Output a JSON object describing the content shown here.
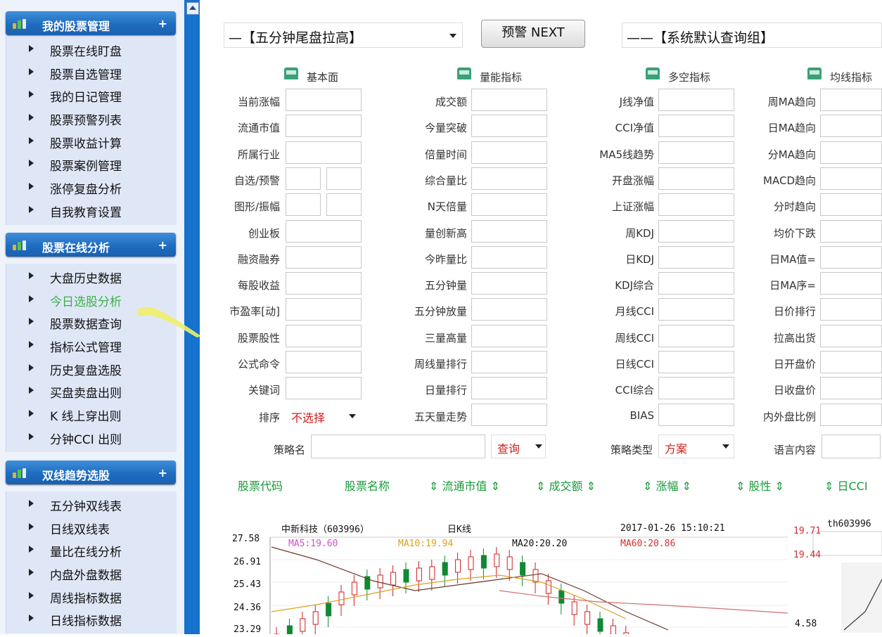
{
  "sidebar": {
    "sections": [
      {
        "title": "我的股票管理",
        "items": [
          "股票在线盯盘",
          "股票自选管理",
          "我的日记管理",
          "股票预警列表",
          "股票收益计算",
          "股票案例管理",
          "涨停复盘分析",
          "自我教育设置"
        ]
      },
      {
        "title": "股票在线分析",
        "items": [
          "大盘历史数据",
          "今日选股分析",
          "股票数据查询",
          "指标公式管理",
          "历史复盘选股",
          "买盘卖盘出则",
          "K 线上穿出则",
          "分钟CCI 出则"
        ]
      },
      {
        "title": "双线趋势选股",
        "items": [
          "五分钟双线表",
          "日线双线表",
          "量比在线分析",
          "内盘外盘数据",
          "周线指标数据",
          "日线指标数据"
        ]
      }
    ],
    "active_item": "今日选股分析",
    "colors": {
      "header": "#1f6cc0",
      "active": "#3fb04a",
      "scrollbar": "#1672cc"
    }
  },
  "toolbar": {
    "strategy_select": "—【五分钟尾盘拉高】",
    "next_button": "预警 NEXT",
    "query_group_select": "——【系统默认查询组】"
  },
  "columns": {
    "fundamental": {
      "title": "基本面",
      "labels": [
        "当前涨幅",
        "流通市值",
        "所属行业",
        "自选/预警",
        "图形/振幅",
        "创业板",
        "融资融券",
        "每股收益",
        "市盈率[动]",
        "股票股性",
        "公式命令",
        "关键词"
      ]
    },
    "volume": {
      "title": "量能指标",
      "labels": [
        "成交额",
        "今量突破",
        "倍量时间",
        "综合量比",
        "N天倍量",
        "量创新高",
        "今昨量比",
        "五分钟量",
        "五分钟放量",
        "三量高量",
        "周线量排行",
        "日量排行",
        "五天量走势"
      ]
    },
    "longshort": {
      "title": "多空指标",
      "labels": [
        "J线净值",
        "CCI净值",
        "MA5线趋势",
        "开盘涨幅",
        "上证涨幅",
        "周KDJ",
        "日KDJ",
        "KDJ综合",
        "月线CCI",
        "周线CCI",
        "日线CCI",
        "CCI综合",
        "BIAS"
      ]
    },
    "ma": {
      "title": "均线指标",
      "labels": [
        "周MA趋向",
        "日MA趋向",
        "分MA趋向",
        "MACD趋向",
        "分时趋向",
        "均价下跌",
        "日MA值=",
        "日MA序=",
        "日价排行",
        "拉高出货",
        "日开盘价",
        "日收盘价",
        "内外盘比例"
      ]
    }
  },
  "sort": {
    "label": "排序",
    "value": "不选择"
  },
  "strategy": {
    "name_label": "策略名",
    "query_button": "查询",
    "type_label": "策略类型",
    "type_value": "方案",
    "memo_label": "语言内容"
  },
  "results_header": [
    "股票代码",
    "股票名称",
    "⇕ 流通市值 ⇕",
    "⇕ 成交额 ⇕",
    "⇕ 涨幅 ⇕",
    "⇕ 股性 ⇕",
    "⇕ 日CCI"
  ],
  "chart_data": {
    "type": "candlestick",
    "title": "中新科技（603996）",
    "period": "日K线",
    "timestamp": "2017-01-26 15:10:21",
    "ma_labels": [
      "MA5:19.60",
      "MA10:19.94",
      "MA20:20.20",
      "MA60:20.86"
    ],
    "y_ticks": [
      "27.58",
      "26.91",
      "25.43",
      "24.36",
      "23.29"
    ],
    "right_labels": [
      "19.71",
      "19.44",
      "4.58"
    ],
    "right_code": "th603996",
    "ylim": [
      23.29,
      27.58
    ]
  }
}
